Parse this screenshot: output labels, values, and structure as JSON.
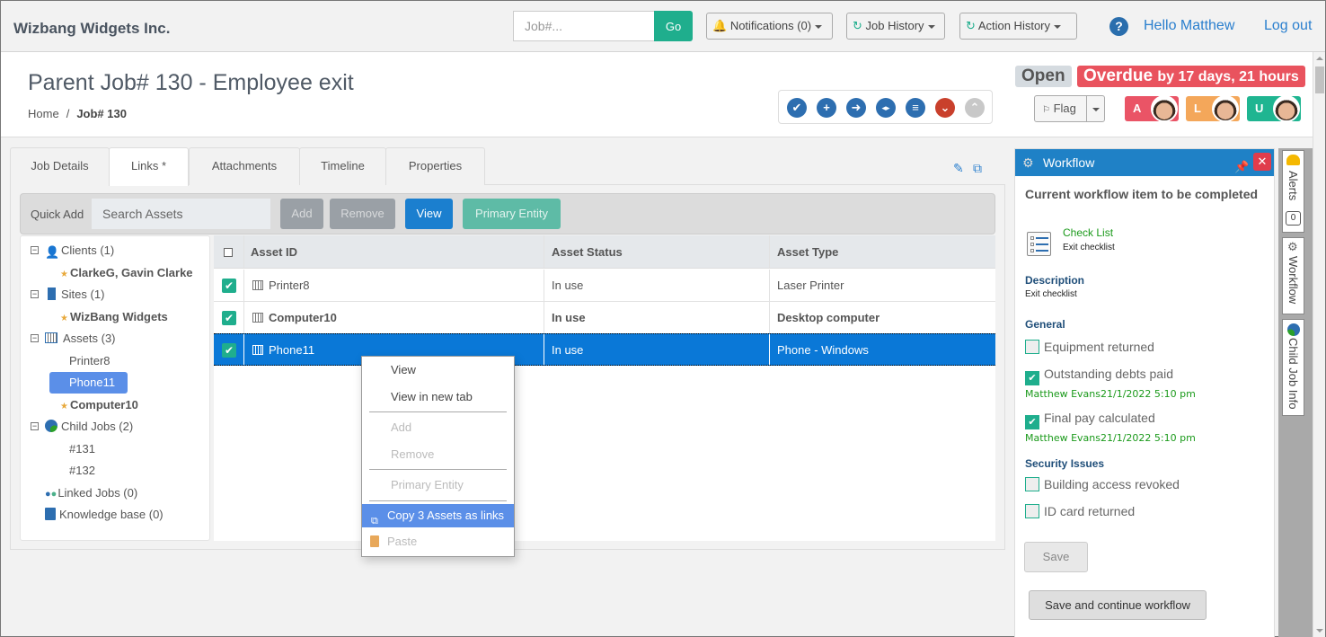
{
  "navbar": {
    "brand": "Wizbang Widgets Inc.",
    "job_search_placeholder": "Job#...",
    "go_label": "Go",
    "notifications_label": "Notifications (0)",
    "job_history_label": "Job History",
    "action_history_label": "Action History",
    "hello": "Hello Matthew",
    "logout": "Log out"
  },
  "header": {
    "title": "Parent Job# 130 - Employee exit",
    "breadcrumb": {
      "home": "Home",
      "separator": "/",
      "current": "Job# 130"
    },
    "status": "Open",
    "overdue_main": "Overdue",
    "overdue_detail": "by 17 days, 21 hours",
    "flag_label": "Flag",
    "actions": [
      {
        "icon": "check-circle-icon",
        "glyph": "✔",
        "color": "#2d6eb0"
      },
      {
        "icon": "plus-circle-icon",
        "glyph": "+",
        "color": "#2d6eb0"
      },
      {
        "icon": "arrow-right-circle-icon",
        "glyph": "➜",
        "color": "#2d6eb0"
      },
      {
        "icon": "split-circle-icon",
        "glyph": "◂▸",
        "color": "#2d6eb0"
      },
      {
        "icon": "list-circle-icon",
        "glyph": "≡",
        "color": "#2d6eb0"
      },
      {
        "icon": "chevron-down-circle-icon",
        "glyph": "⌄",
        "color": "#c9402c"
      },
      {
        "icon": "chevron-up-circle-icon",
        "glyph": "⌃",
        "color": "#c8c8c8"
      }
    ],
    "people": [
      {
        "letter": "A",
        "color": "#ea5466"
      },
      {
        "letter": "L",
        "color": "#f4a75a"
      },
      {
        "letter": "U",
        "color": "#1fb591"
      }
    ]
  },
  "tabs": [
    {
      "label": "Job Details",
      "active": false
    },
    {
      "label": "Links *",
      "active": true
    },
    {
      "label": "Attachments",
      "active": false
    },
    {
      "label": "Timeline",
      "active": false
    },
    {
      "label": "Properties",
      "active": false
    }
  ],
  "quick_add": {
    "label": "Quick Add",
    "search_placeholder": "Search Assets",
    "buttons": {
      "add": "Add",
      "remove": "Remove",
      "view": "View",
      "primary_entity": "Primary Entity"
    }
  },
  "tree": {
    "clients": {
      "label": "Clients (1)",
      "children": [
        "ClarkeG, Gavin Clarke"
      ]
    },
    "sites": {
      "label": "Sites (1)",
      "children": [
        "WizBang Widgets"
      ]
    },
    "assets": {
      "label": "Assets (3)",
      "children": [
        "Printer8",
        "Phone11",
        "Computer10"
      ]
    },
    "child_jobs": {
      "label": "Child Jobs (2)",
      "children": [
        "#131",
        "#132"
      ]
    },
    "linked_jobs": "Linked Jobs (0)",
    "knowledge_base": "Knowledge base (0)"
  },
  "grid": {
    "columns": [
      "Asset ID",
      "Asset Status",
      "Asset Type"
    ],
    "rows": [
      {
        "id": "Printer8",
        "status": "In use",
        "type": "Laser Printer",
        "checked": true,
        "bold": false,
        "selected": false
      },
      {
        "id": "Computer10",
        "status": "In use",
        "type": "Desktop computer",
        "checked": true,
        "bold": true,
        "selected": false
      },
      {
        "id": "Phone11",
        "status": "In use",
        "type": "Phone - Windows",
        "checked": true,
        "bold": false,
        "selected": true
      }
    ]
  },
  "context_menu": {
    "view": "View",
    "view_new_tab": "View in new tab",
    "add": "Add",
    "remove": "Remove",
    "primary_entity": "Primary Entity",
    "copy": "Copy 3 Assets as links",
    "paste": "Paste"
  },
  "workflow": {
    "title": "Workflow",
    "current_item_heading": "Current workflow item to be completed",
    "item_link": "Check List",
    "item_sub": "Exit checklist",
    "description_heading": "Description",
    "description": "Exit checklist",
    "general_heading": "General",
    "general_items": [
      {
        "label": "Equipment returned",
        "checked": false,
        "meta": ""
      },
      {
        "label": "Outstanding debts paid",
        "checked": true,
        "meta": "Matthew Evans21/1/2022 5:10 pm"
      },
      {
        "label": "Final pay calculated",
        "checked": true,
        "meta": "Matthew Evans21/1/2022 5:10 pm"
      }
    ],
    "security_heading": "Security Issues",
    "security_items": [
      {
        "label": "Building access revoked",
        "checked": false
      },
      {
        "label": "ID card returned",
        "checked": false
      }
    ],
    "save": "Save",
    "save_continue": "Save and continue workflow"
  },
  "rail": {
    "alerts": "Alerts",
    "alerts_count": "0",
    "workflow": "Workflow",
    "child_job_info": "Child Job Info"
  }
}
